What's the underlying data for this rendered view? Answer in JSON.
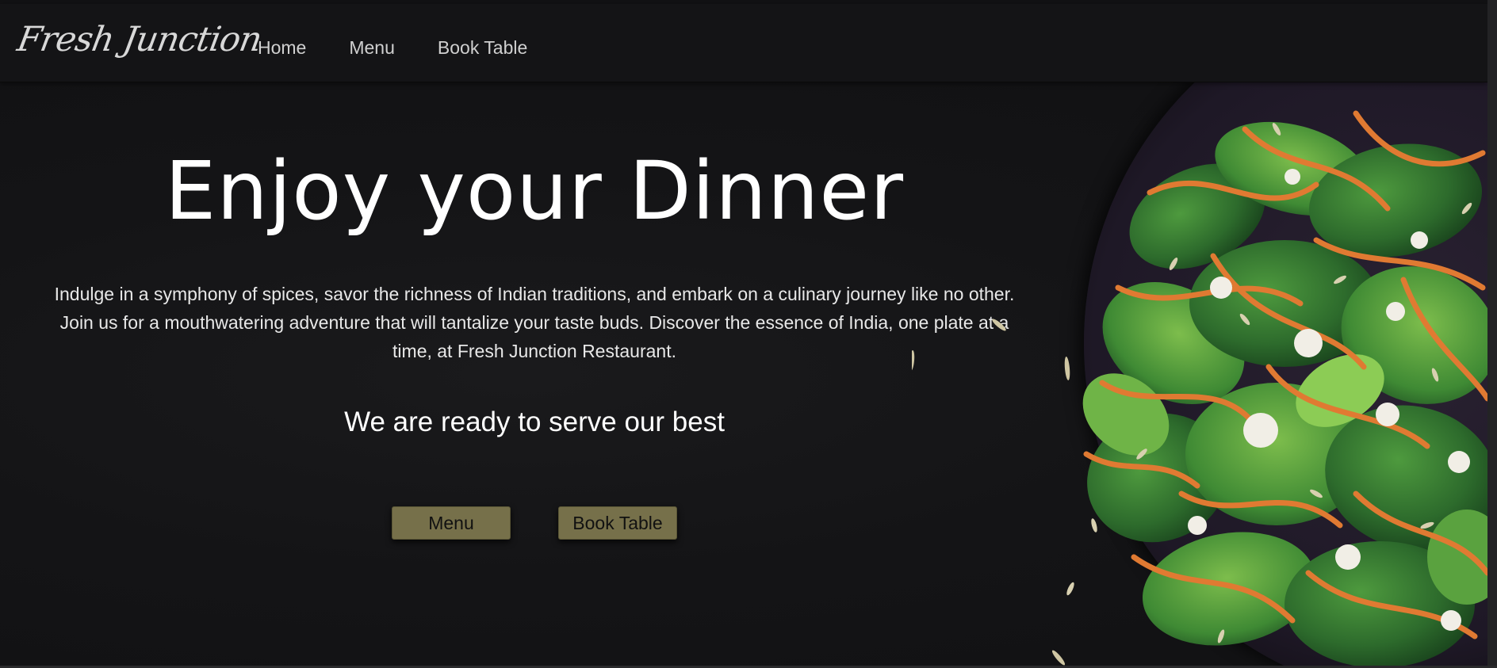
{
  "navbar": {
    "brand": "Fresh Junction",
    "links": [
      {
        "label": "Home"
      },
      {
        "label": "Menu"
      },
      {
        "label": "Book Table"
      }
    ]
  },
  "hero": {
    "title": "Enjoy your Dinner",
    "description": "Indulge in a symphony of spices, savor the richness of Indian traditions, and embark on a culinary journey like no other. Join us for a mouthwatering adventure that will tantalize your taste buds. Discover the essence of India, one plate at a time, at Fresh Junction Restaurant.",
    "tagline": "We are ready to serve our best",
    "buttons": {
      "menu": "Menu",
      "book_table": "Book Table"
    },
    "image": {
      "icon": "salad-bowl-image",
      "plate_color": "#1e1826",
      "greens_color": "#2d6b2c",
      "carrot_color": "#e07a32"
    }
  },
  "colors": {
    "background": "#121214",
    "navbar": "#141416",
    "button": "#76704a",
    "text": "#ffffff"
  }
}
